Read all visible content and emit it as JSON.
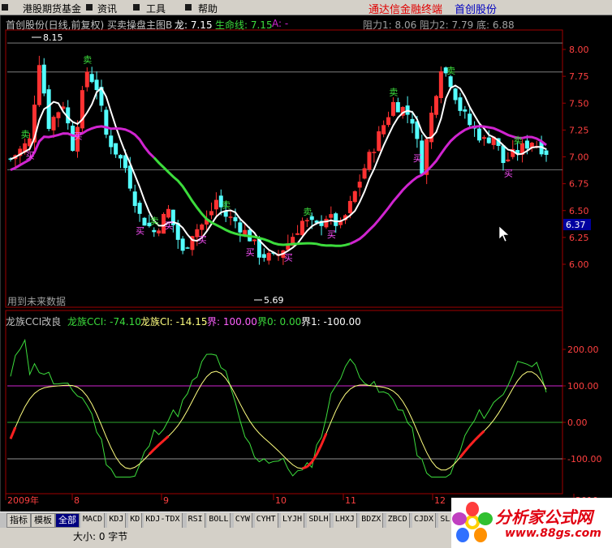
{
  "menu": {
    "items": [
      "港股期货基金",
      "资讯",
      "工具",
      "帮助"
    ],
    "promo": "通达信金融终端",
    "stock": "首创股份"
  },
  "main_header": {
    "title": "首创股份(日线,前复权) 买卖操盘主图B",
    "long_label": "龙: 7.15",
    "lifeline_label": "生命线: 7.15",
    "a_label": "A: -",
    "resistance": "阻力1: 8.06  阻力2: 7.79  底: 6.88"
  },
  "main_chart": {
    "price_ticks": [
      "8.00",
      "7.75",
      "7.50",
      "7.25",
      "7.00",
      "6.75",
      "6.50",
      "6.25",
      "6.00"
    ],
    "current_price": "6.37",
    "high_label": "8.15",
    "low_label": "5.69",
    "future_label": "用到未来数据",
    "buy_label": "买",
    "sell_label": "卖",
    "colors": {
      "up": "#ff3232",
      "down": "#54ffff",
      "ma_white": "#ffffff",
      "ma_green": "#3cdc3c",
      "ma_magenta": "#d024d0"
    }
  },
  "sub_header": {
    "title": "龙族CCI改良",
    "cci": "龙族CCI: -74.10",
    "ci": "龙族CI: -14.15",
    "j100": "界: 100.00",
    "j0": "界0: 0.00",
    "j1": "界1: -100.00"
  },
  "sub_chart": {
    "ticks": [
      "200.00",
      "100.00",
      "0.00",
      "-100.00"
    ]
  },
  "time_axis": {
    "labels": [
      "2009年",
      "8",
      "9",
      "10",
      "11",
      "12",
      "2010"
    ]
  },
  "tabs": {
    "primary": [
      "指标",
      "模板",
      "全部"
    ],
    "indicators": [
      "MACD",
      "KDJ",
      "KD",
      "KDJ-TDX",
      "RSI",
      "BOLL",
      "CYW",
      "CYHT",
      "LYJH",
      "SDLH",
      "LHXJ",
      "BDZX",
      "ZBCD",
      "CJDX",
      "SL"
    ]
  },
  "status": {
    "text": "大小: 0 字节"
  },
  "logo": {
    "name": "分析家公式网",
    "url": "www.88gs.com"
  }
}
